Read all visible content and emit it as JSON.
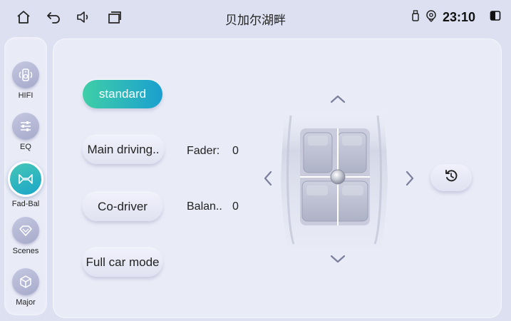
{
  "status_bar": {
    "title": "贝加尔湖畔",
    "time": "23:10",
    "icons": [
      "home-icon",
      "back-icon",
      "volume-icon",
      "window-icon",
      "usb-icon",
      "location-icon",
      "split-screen-icon"
    ]
  },
  "sidebar": {
    "items": [
      {
        "label": "HIFI",
        "icon": "speaker-icon"
      },
      {
        "label": "EQ",
        "icon": "sliders-icon"
      },
      {
        "label": "Fad-Bal",
        "icon": "fader-balance-icon",
        "active": true
      },
      {
        "label": "Scenes",
        "icon": "diamond-icon"
      },
      {
        "label": "Major",
        "icon": "cube-icon"
      }
    ]
  },
  "modes": {
    "standard": "standard",
    "main_driving": "Main driving..",
    "co_driver": "Co-driver",
    "full_car": "Full car mode",
    "selected": "standard"
  },
  "values": {
    "fader_label": "Fader:",
    "fader_value": "0",
    "balance_label": "Balan..",
    "balance_value": "0"
  },
  "colors": {
    "accent_start": "#3fcfa7",
    "accent_end": "#1b9fcf",
    "background": "#dde0f1",
    "panel": "#e9ebf7"
  }
}
